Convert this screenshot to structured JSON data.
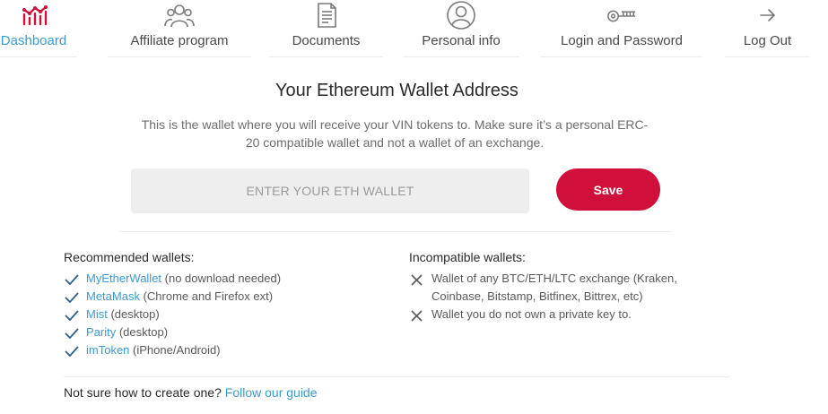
{
  "nav": {
    "items": [
      {
        "label": "Dashboard",
        "icon": "chart-icon",
        "active": true
      },
      {
        "label": "Affiliate program",
        "icon": "users-icon"
      },
      {
        "label": "Documents",
        "icon": "document-icon"
      },
      {
        "label": "Personal info",
        "icon": "user-icon"
      },
      {
        "label": "Login and Password",
        "icon": "key-icon"
      },
      {
        "label": "Log Out",
        "icon": "arrow-right-icon"
      }
    ]
  },
  "main": {
    "title": "Your Ethereum Wallet Address",
    "subtitle": "This is the wallet where you will receive your VIN tokens to. Make sure it’s a personal ERC-20 compatible wallet and not a wallet of an exchange.",
    "input": {
      "placeholder": "ENTER YOUR ETH WALLET",
      "value": ""
    },
    "save_label": "Save"
  },
  "recommended": {
    "heading": "Recommended wallets:",
    "items": [
      {
        "link": "MyEtherWallet",
        "note": " (no download needed)"
      },
      {
        "link": "MetaMask",
        "note": " (Chrome and Firefox ext)"
      },
      {
        "link": "Mist",
        "note": " (desktop)"
      },
      {
        "link": "Parity",
        "note": " (desktop)"
      },
      {
        "link": "imToken",
        "note": " (iPhone/Android)"
      }
    ]
  },
  "incompatible": {
    "heading": "Incompatible wallets:",
    "items": [
      {
        "line1": "Wallet of any BTC/ETH/LTC exchange (Kraken,",
        "line2": "Coinbase, Bitstamp, Bitfinex, Bittrex, etc)"
      },
      {
        "line1": "Wallet you do not own a private key to."
      }
    ]
  },
  "footer": {
    "text": "Not sure how to create one? ",
    "link": "Follow our guide"
  },
  "colors": {
    "accent": "#d0103a",
    "link": "#3d9ad3",
    "icon": "#7a7a7a"
  }
}
